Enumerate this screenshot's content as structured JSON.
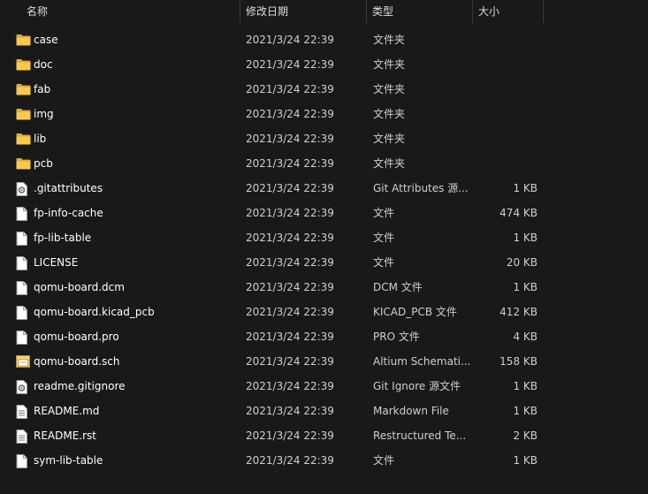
{
  "header": {
    "name": "名称",
    "date": "修改日期",
    "type": "类型",
    "size": "大小",
    "sort_indicator": "^"
  },
  "colors": {
    "background": "#191919",
    "folder": "#f5c249",
    "file": "#ffffff"
  },
  "rows": [
    {
      "icon": "folder-icon",
      "name": "case",
      "date": "2021/3/24 22:39",
      "type": "文件夹",
      "size": ""
    },
    {
      "icon": "folder-icon",
      "name": "doc",
      "date": "2021/3/24 22:39",
      "type": "文件夹",
      "size": ""
    },
    {
      "icon": "folder-icon",
      "name": "fab",
      "date": "2021/3/24 22:39",
      "type": "文件夹",
      "size": ""
    },
    {
      "icon": "folder-icon",
      "name": "img",
      "date": "2021/3/24 22:39",
      "type": "文件夹",
      "size": ""
    },
    {
      "icon": "folder-icon",
      "name": "lib",
      "date": "2021/3/24 22:39",
      "type": "文件夹",
      "size": ""
    },
    {
      "icon": "folder-icon",
      "name": "pcb",
      "date": "2021/3/24 22:39",
      "type": "文件夹",
      "size": ""
    },
    {
      "icon": "config-file-icon",
      "name": ".gitattributes",
      "date": "2021/3/24 22:39",
      "type": "Git Attributes 源...",
      "size": "1 KB"
    },
    {
      "icon": "file-icon",
      "name": "fp-info-cache",
      "date": "2021/3/24 22:39",
      "type": "文件",
      "size": "474 KB"
    },
    {
      "icon": "file-icon",
      "name": "fp-lib-table",
      "date": "2021/3/24 22:39",
      "type": "文件",
      "size": "1 KB"
    },
    {
      "icon": "file-icon",
      "name": "LICENSE",
      "date": "2021/3/24 22:39",
      "type": "文件",
      "size": "20 KB"
    },
    {
      "icon": "file-icon",
      "name": "qomu-board.dcm",
      "date": "2021/3/24 22:39",
      "type": "DCM 文件",
      "size": "1 KB"
    },
    {
      "icon": "file-icon",
      "name": "qomu-board.kicad_pcb",
      "date": "2021/3/24 22:39",
      "type": "KICAD_PCB 文件",
      "size": "412 KB"
    },
    {
      "icon": "file-icon",
      "name": "qomu-board.pro",
      "date": "2021/3/24 22:39",
      "type": "PRO 文件",
      "size": "4 KB"
    },
    {
      "icon": "schematic-file-icon",
      "name": "qomu-board.sch",
      "date": "2021/3/24 22:39",
      "type": "Altium Schemati...",
      "size": "158 KB"
    },
    {
      "icon": "config-file-icon",
      "name": "readme.gitignore",
      "date": "2021/3/24 22:39",
      "type": "Git Ignore 源文件",
      "size": "1 KB"
    },
    {
      "icon": "text-file-icon",
      "name": "README.md",
      "date": "2021/3/24 22:39",
      "type": "Markdown File",
      "size": "1 KB"
    },
    {
      "icon": "text-file-icon",
      "name": "README.rst",
      "date": "2021/3/24 22:39",
      "type": "Restructured Te...",
      "size": "2 KB"
    },
    {
      "icon": "file-icon",
      "name": "sym-lib-table",
      "date": "2021/3/24 22:39",
      "type": "文件",
      "size": "1 KB"
    }
  ]
}
